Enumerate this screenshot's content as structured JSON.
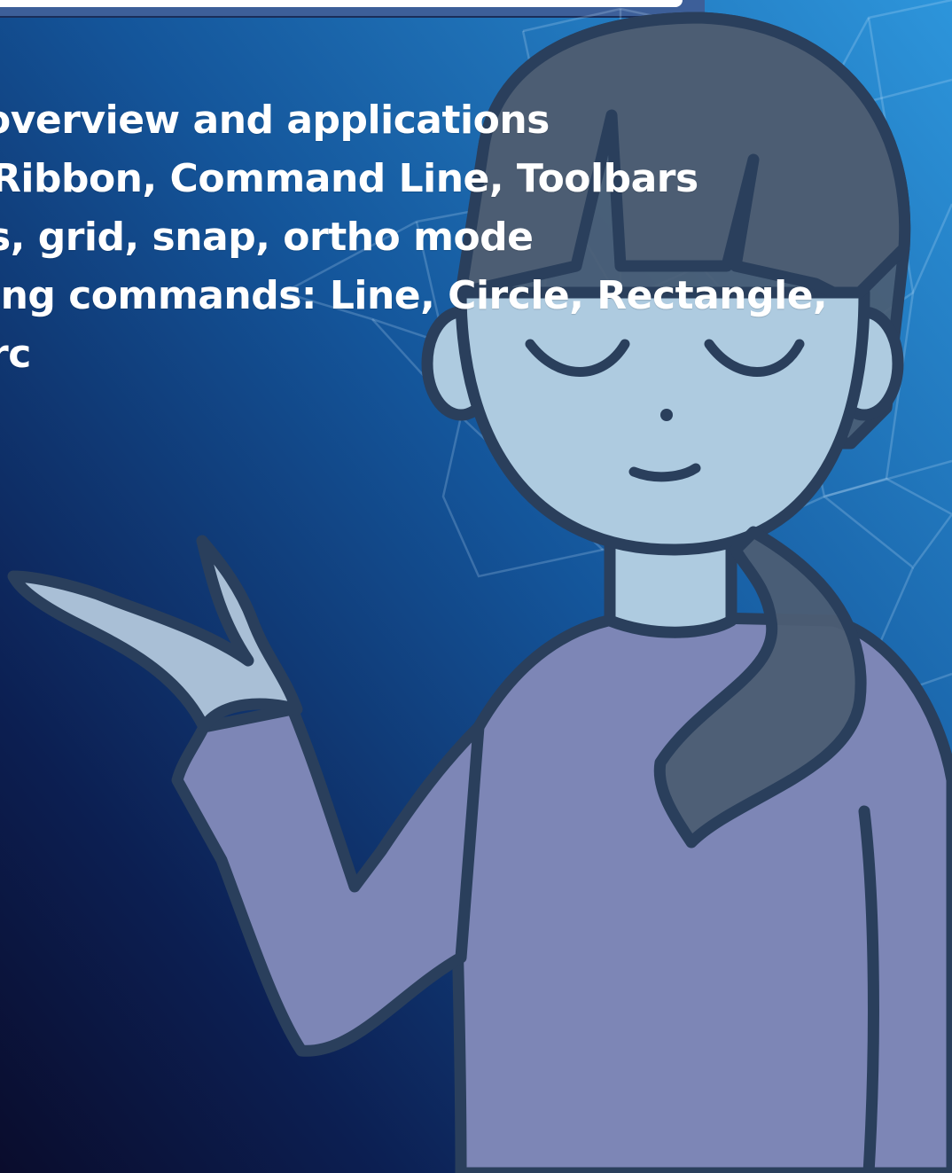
{
  "slide": {
    "lines": [
      "overview and applications",
      "Ribbon, Command Line, Toolbars",
      "s, grid, snap, ortho mode",
      "ing commands: Line, Circle, Rectangle,",
      "rc"
    ]
  },
  "colors": {
    "background_top": "#2d8fd6",
    "background_bottom": "#0b1238",
    "text": "#ffffff",
    "outline": "#2a3f5c",
    "sweater": "#7c84b4",
    "skin": "#aecbe0",
    "hair": "#3f5066"
  }
}
